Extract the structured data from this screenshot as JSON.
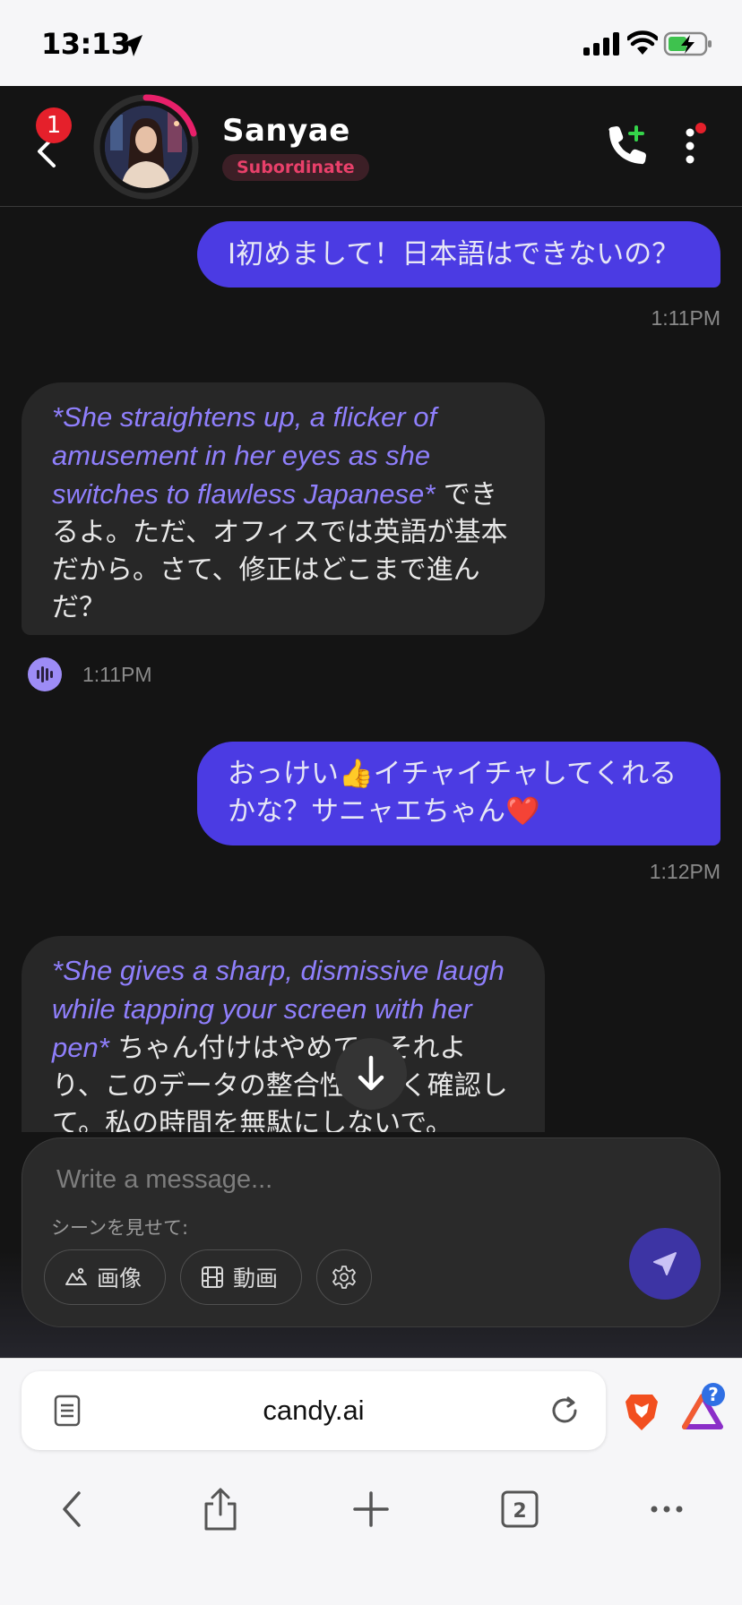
{
  "status_bar": {
    "time": "13:13"
  },
  "header": {
    "notification_count": "1",
    "contact_name": "Sanyae",
    "role": "Subordinate"
  },
  "messages": [
    {
      "sender": "user",
      "text": "I初めまして！日本語はできないの？",
      "time": "1:11PM"
    },
    {
      "sender": "ai",
      "action": "*She straightens up, a flicker of amusement in her eyes as she switches to flawless Japanese*",
      "text": " できるよ。ただ、オフィスでは英語が基本だから。さて、修正はどこまで進んだ？",
      "time": "1:11PM"
    },
    {
      "sender": "user",
      "text": "おっけい👍イチャイチャしてくれるかな？サニャエちゃん❤️",
      "time": "1:12PM"
    },
    {
      "sender": "ai",
      "action": "*She gives a sharp, dismissive laugh while tapping your screen with her pen*",
      "text": " ちゃん付けはやめて。それより、このデータの整合性を早く確認して。私の時間を無駄にしないで。"
    }
  ],
  "composer": {
    "placeholder": "Write a message...",
    "scene_label": "シーンを見せて:",
    "image_label": "画像",
    "video_label": "動画"
  },
  "browser": {
    "url": "candy.ai",
    "tab_count": "2",
    "rewards_badge": "?"
  },
  "colors": {
    "user_bubble": "#4b3be3",
    "ai_bubble": "#272727",
    "action_text": "#8f7ffc",
    "role_badge_text": "#e8406a",
    "app_background": "#141414"
  }
}
